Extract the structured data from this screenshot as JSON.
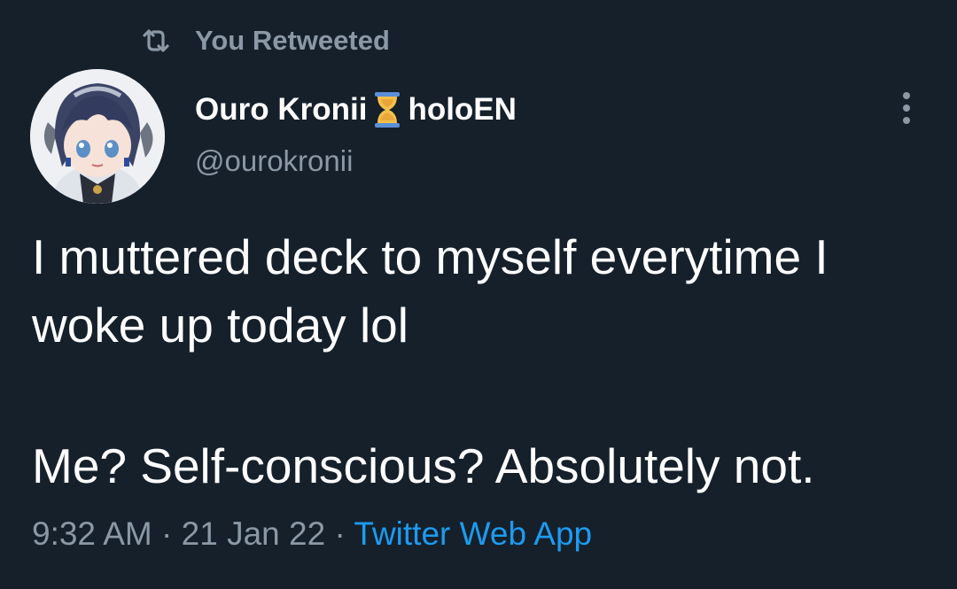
{
  "social_context": {
    "icon": "retweet-icon",
    "text": "You Retweeted"
  },
  "author": {
    "avatar_icon": "anime-character-avatar",
    "name_part1": "Ouro Kronii",
    "emoji": "hourglass-icon",
    "name_part2": "holoEN",
    "handle": "@ourokronii"
  },
  "menu": {
    "icon": "more-options-icon"
  },
  "tweet": {
    "line1": "I muttered deck to myself everytime I",
    "line2": "woke up today lol",
    "line3": "Me? Self-conscious? Absolutely not."
  },
  "meta": {
    "time": "9:32 AM",
    "sep1": " · ",
    "date": "21 Jan 22",
    "sep2": " · ",
    "source": "Twitter Web App"
  },
  "colors": {
    "background": "#15202b",
    "primary_text": "#ffffff",
    "secondary_text": "#8b98a5",
    "link": "#1d9bf0"
  }
}
